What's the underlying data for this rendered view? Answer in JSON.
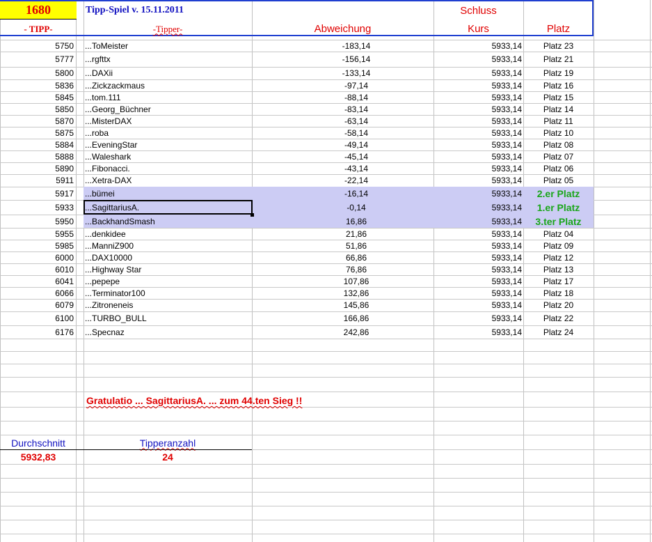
{
  "header": {
    "count": "1680",
    "title": "Tipp-Spiel v. 15.11.2011",
    "col_tipp": "- TIPP-",
    "col_tipper": "-Tipper-",
    "col_abweichung": "Abweichung",
    "col_kurs_line1": "Schluss",
    "col_kurs_line2": "Kurs",
    "col_platz": "Platz"
  },
  "rows": [
    {
      "tipp": "5750",
      "tipper": "...ToMeister",
      "abw": "-183,14",
      "kurs": "5933,14",
      "platz": "Platz 23"
    },
    {
      "tipp": "5777",
      "tipper": "...rgfttx",
      "abw": "-156,14",
      "kurs": "5933,14",
      "platz": "Platz 21"
    },
    {
      "tipp": "5800",
      "tipper": "...DAXii",
      "abw": "-133,14",
      "kurs": "5933,14",
      "platz": "Platz 19"
    },
    {
      "tipp": "5836",
      "tipper": "...Zickzackmaus",
      "abw": "-97,14",
      "kurs": "5933,14",
      "platz": "Platz 16"
    },
    {
      "tipp": "5845",
      "tipper": "...tom.111",
      "abw": "-88,14",
      "kurs": "5933,14",
      "platz": "Platz 15"
    },
    {
      "tipp": "5850",
      "tipper": "...Georg_Büchner",
      "abw": "-83,14",
      "kurs": "5933,14",
      "platz": "Platz 14"
    },
    {
      "tipp": "5870",
      "tipper": "...MisterDAX",
      "abw": "-63,14",
      "kurs": "5933,14",
      "platz": "Platz 11"
    },
    {
      "tipp": "5875",
      "tipper": "...roba",
      "abw": "-58,14",
      "kurs": "5933,14",
      "platz": "Platz 10"
    },
    {
      "tipp": "5884",
      "tipper": "...EveningStar",
      "abw": "-49,14",
      "kurs": "5933,14",
      "platz": "Platz 08"
    },
    {
      "tipp": "5888",
      "tipper": "...Waleshark",
      "abw": "-45,14",
      "kurs": "5933,14",
      "platz": "Platz 07"
    },
    {
      "tipp": "5890",
      "tipper": "...Fibonacci.",
      "abw": "-43,14",
      "kurs": "5933,14",
      "platz": "Platz 06"
    },
    {
      "tipp": "5911",
      "tipper": "...Xetra-DAX",
      "abw": "-22,14",
      "kurs": "5933,14",
      "platz": "Platz 05"
    },
    {
      "tipp": "5917",
      "tipper": "...bümei",
      "abw": "-16,14",
      "kurs": "5933,14",
      "platz": "2.er Platz",
      "winner": true
    },
    {
      "tipp": "5933",
      "tipper": "...SagittariusA.",
      "abw": "-0,14",
      "kurs": "5933,14",
      "platz": "1.er Platz",
      "winner": true,
      "selected": true
    },
    {
      "tipp": "5950",
      "tipper": "...BackhandSmash",
      "abw": "16,86",
      "kurs": "5933,14",
      "platz": "3.ter Platz",
      "winner": true
    },
    {
      "tipp": "5955",
      "tipper": "...denkidee",
      "abw": "21,86",
      "kurs": "5933,14",
      "platz": "Platz 04"
    },
    {
      "tipp": "5985",
      "tipper": "...ManniZ900",
      "abw": "51,86",
      "kurs": "5933,14",
      "platz": "Platz 09"
    },
    {
      "tipp": "6000",
      "tipper": "...DAX10000",
      "abw": "66,86",
      "kurs": "5933,14",
      "platz": "Platz 12"
    },
    {
      "tipp": "6010",
      "tipper": "...Highway Star",
      "abw": "76,86",
      "kurs": "5933,14",
      "platz": "Platz 13"
    },
    {
      "tipp": "6041",
      "tipper": "...pepepe",
      "abw": "107,86",
      "kurs": "5933,14",
      "platz": "Platz 17"
    },
    {
      "tipp": "6066",
      "tipper": "...Terminator100",
      "abw": "132,86",
      "kurs": "5933,14",
      "platz": "Platz 18"
    },
    {
      "tipp": "6079",
      "tipper": "...Zitroneneis",
      "abw": "145,86",
      "kurs": "5933,14",
      "platz": "Platz 20"
    },
    {
      "tipp": "6100",
      "tipper": "...TURBO_BULL",
      "abw": "166,86",
      "kurs": "5933,14",
      "platz": "Platz 22"
    },
    {
      "tipp": "6176",
      "tipper": "...Specnaz",
      "abw": "242,86",
      "kurs": "5933,14",
      "platz": "Platz 24"
    }
  ],
  "congrats": "Gratulatio  ...  SagittariusA.  ... zum   44.ten Sieg !!",
  "summary": {
    "avg_label": "Durchschnitt",
    "avg_value": "5932,83",
    "count_label": "Tipperanzahl",
    "count_value": "24"
  },
  "colors": {
    "header_yellow": "#ffff00",
    "header_blue_border": "#1f3fd0",
    "red": "#e00000",
    "green": "#1aa61a",
    "winner_highlight": "#ccccf4"
  }
}
